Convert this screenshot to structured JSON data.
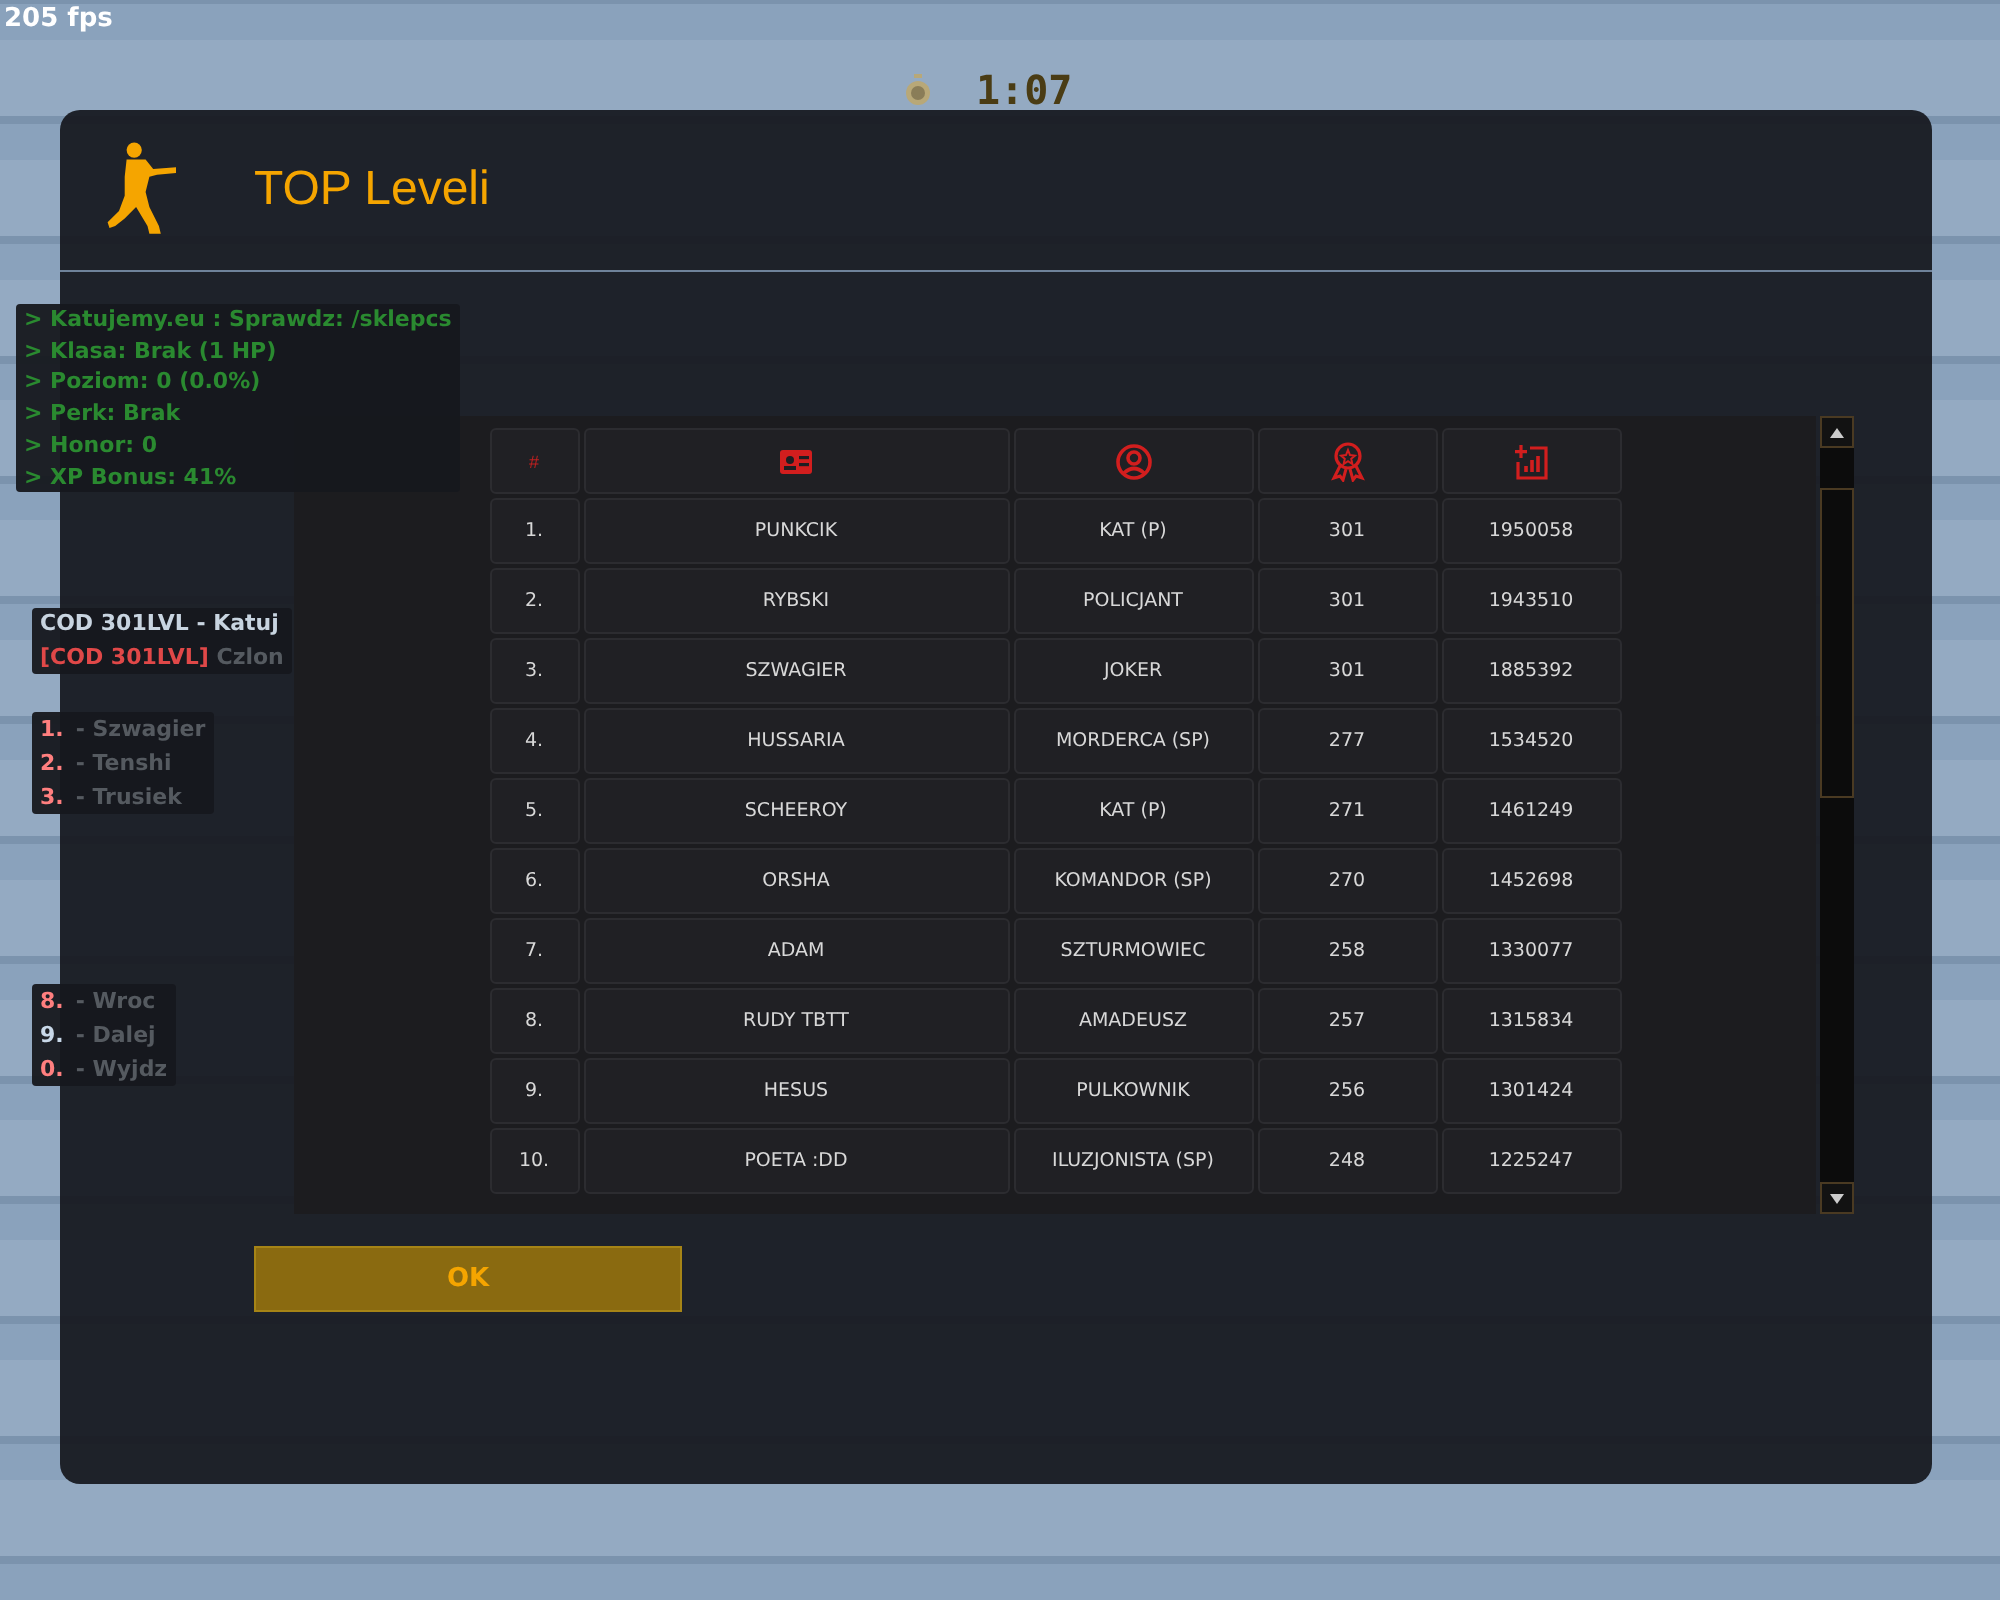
{
  "hud": {
    "fps": "205 fps",
    "timer": "1:07"
  },
  "info_lines": [
    "> Katujemy.eu : Sprawdz: /sklepcs",
    "> Klasa: Brak (1 HP)",
    "> Poziom: 0 (0.0%)",
    "> Perk: Brak",
    "> Honor: 0",
    "> XP Bonus: 41%"
  ],
  "server_lines": [
    [
      {
        "kind": "plain",
        "text": "COD 301LVL - Katuj"
      }
    ],
    [
      {
        "kind": "tag",
        "text": "[COD 301LVL]"
      },
      {
        "kind": "dim",
        "text": " Czlon"
      }
    ]
  ],
  "menu_top": [
    {
      "key": "1.",
      "label": "- Szwagier",
      "color": "#ff7f7f"
    },
    {
      "key": "2.",
      "label": "- Tenshi",
      "color": "#ff7f7f"
    },
    {
      "key": "3.",
      "label": "- Trusiek",
      "color": "#ff7f7f"
    }
  ],
  "menu_bottom": [
    {
      "key": "8.",
      "label": "- Wroc",
      "color": "#ff7f7f"
    },
    {
      "key": "9.",
      "label": "- Dalej",
      "color": "#c8d8e8"
    },
    {
      "key": "0.",
      "label": "- Wyjdz",
      "color": "#ff7f7f"
    }
  ],
  "dialog": {
    "title": "TOP Leveli",
    "table": {
      "rank_header": "#",
      "rows": [
        [
          "1.",
          "PUNKCIK",
          "KAT (P)",
          "301",
          "1950058"
        ],
        [
          "2.",
          "RYBSKI",
          "POLICJANT",
          "301",
          "1943510"
        ],
        [
          "3.",
          "SZWAGIER",
          "JOKER",
          "301",
          "1885392"
        ],
        [
          "4.",
          "HUSSARIA",
          "MORDERCA (SP)",
          "277",
          "1534520"
        ],
        [
          "5.",
          "SCHEEROY",
          "KAT (P)",
          "271",
          "1461249"
        ],
        [
          "6.",
          "ORSHA",
          "KOMANDOR (SP)",
          "270",
          "1452698"
        ],
        [
          "7.",
          "ADAM",
          "SZTURMOWIEC",
          "258",
          "1330077"
        ],
        [
          "8.",
          "RUDY TBTT",
          "AMADEUSZ",
          "257",
          "1315834"
        ],
        [
          "9.",
          "HESUS",
          "PULKOWNIK",
          "256",
          "1301424"
        ],
        [
          "10.",
          "POETA :DD",
          "ILUZJONISTA (SP)",
          "248",
          "1225247"
        ]
      ]
    },
    "ok_button": "OK"
  }
}
